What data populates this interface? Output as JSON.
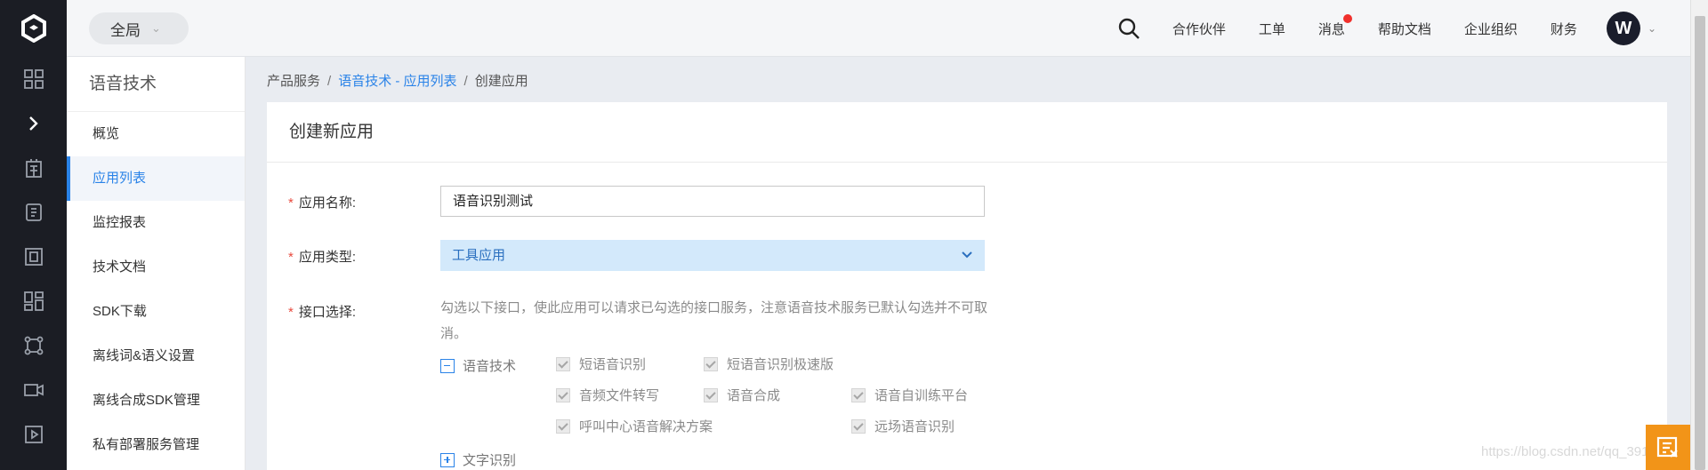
{
  "topbar": {
    "scope_label": "全局",
    "nav": [
      "合作伙伴",
      "工单",
      "消息",
      "帮助文档",
      "企业组织",
      "财务"
    ],
    "avatar_initial": "W",
    "notification_color": "#f0302c"
  },
  "rail": {
    "icons": [
      "logo-icon",
      "grid-icon",
      "expand-chevron-icon",
      "building-icon",
      "document-icon",
      "frame-icon",
      "apps-icon",
      "nodes-icon",
      "video-icon",
      "play-icon"
    ]
  },
  "sidebar": {
    "title": "语音技术",
    "items": [
      {
        "label": "概览",
        "active": false
      },
      {
        "label": "应用列表",
        "active": true
      },
      {
        "label": "监控报表",
        "active": false
      },
      {
        "label": "技术文档",
        "active": false
      },
      {
        "label": "SDK下载",
        "active": false
      },
      {
        "label": "离线词&语义设置",
        "active": false
      },
      {
        "label": "离线合成SDK管理",
        "active": false
      },
      {
        "label": "私有部署服务管理",
        "active": false
      }
    ]
  },
  "breadcrumb": {
    "items": [
      "产品服务",
      "语音技术 - 应用列表",
      "创建应用"
    ],
    "separator": "/"
  },
  "form": {
    "title": "创建新应用",
    "required_mark": "*",
    "app_name_label": "应用名称:",
    "app_name_value": "语音识别测试",
    "app_type_label": "应用类型:",
    "app_type_value": "工具应用",
    "api_label": "接口选择:",
    "api_hint": "勾选以下接口，使此应用可以请求已勾选的接口服务，注意语音技术服务已默认勾选并不可取消。",
    "groups": [
      {
        "name": "语音技术",
        "expanded": true,
        "options": [
          "短语音识别",
          "短语音识别极速版",
          "音频文件转写",
          "语音合成",
          "语音自训练平台",
          "呼叫中心语音解决方案",
          "远场语音识别"
        ]
      },
      {
        "name": "文字识别",
        "expanded": false,
        "options": []
      }
    ]
  },
  "watermark": "https://blog.csdn.net/qq_39136006",
  "colors": {
    "accent": "#2a83e8",
    "select_bg": "#d3e9fb",
    "fab": "#f29418",
    "required": "#e84a3e"
  }
}
